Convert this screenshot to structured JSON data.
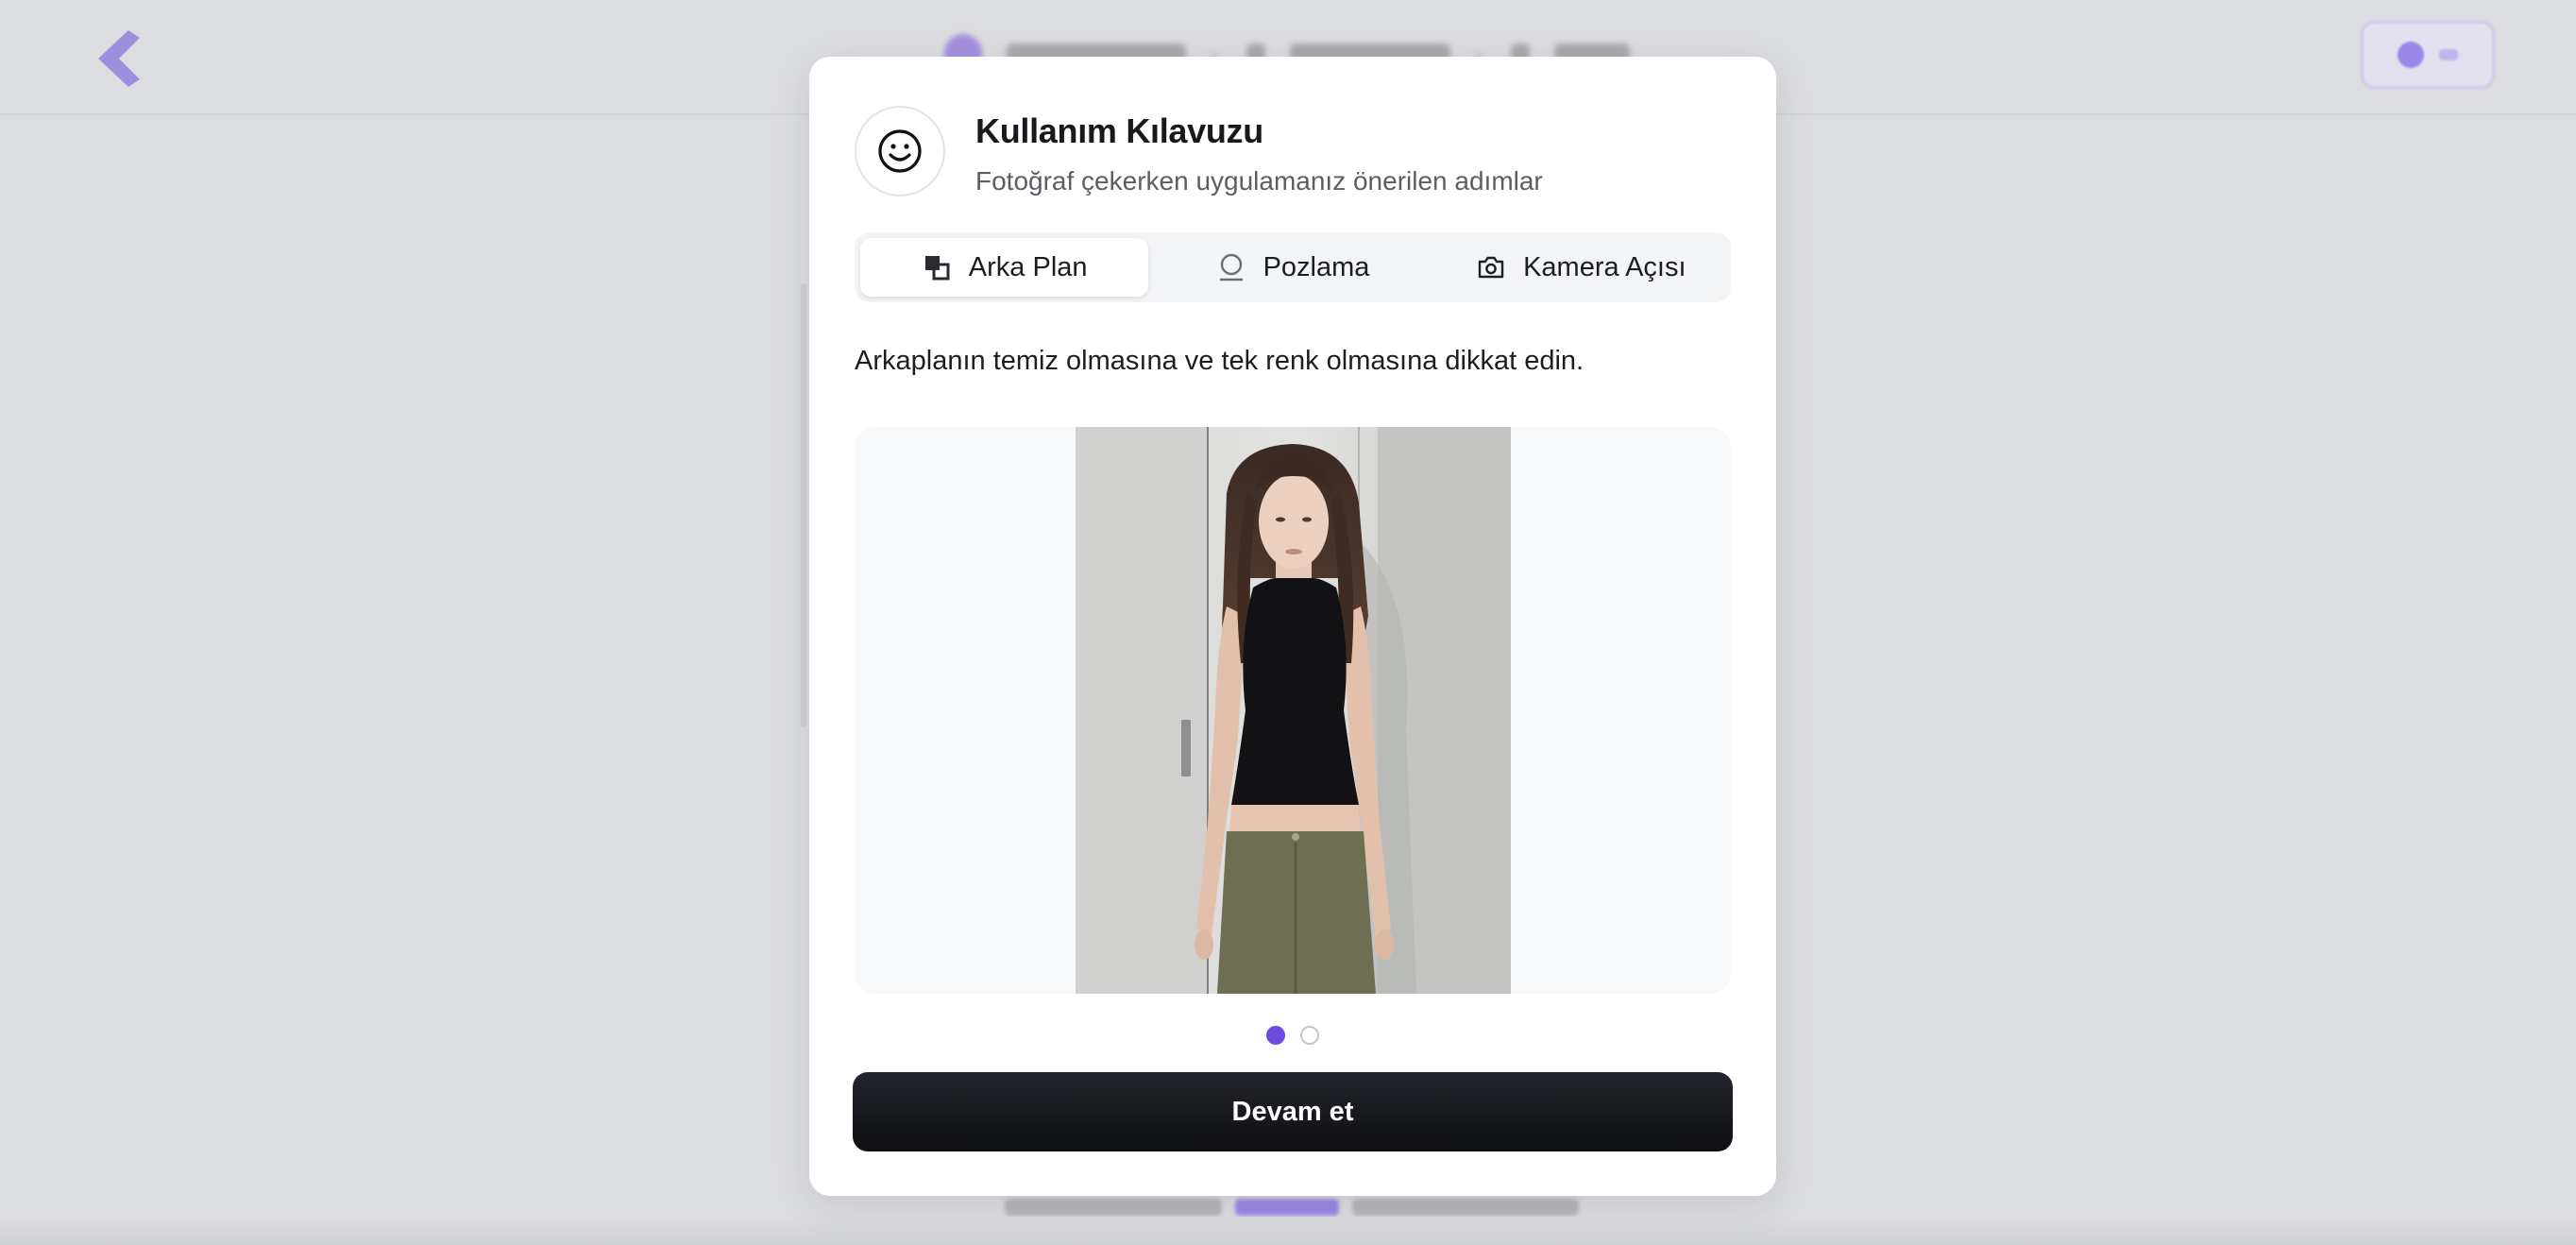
{
  "modal": {
    "title": "Kullanım Kılavuzu",
    "subtitle": "Fotoğraf çekerken uygulamanız önerilen adımlar",
    "header_icon": "smile-icon",
    "tabs": [
      {
        "label": "Arka Plan",
        "icon": "layers-icon",
        "active": true
      },
      {
        "label": "Pozlama",
        "icon": "exposure-icon",
        "active": false
      },
      {
        "label": "Kamera Açısı",
        "icon": "camera-icon",
        "active": false
      }
    ],
    "description": "Arkaplanın temiz olmasına ve tek renk olmasına dikkat edin.",
    "slides": {
      "count": 2,
      "current": 1
    },
    "cta_label": "Devam et"
  },
  "colors": {
    "accent": "#6d4be0",
    "cta_background": "#111216",
    "overlay": "#dcdde0"
  }
}
